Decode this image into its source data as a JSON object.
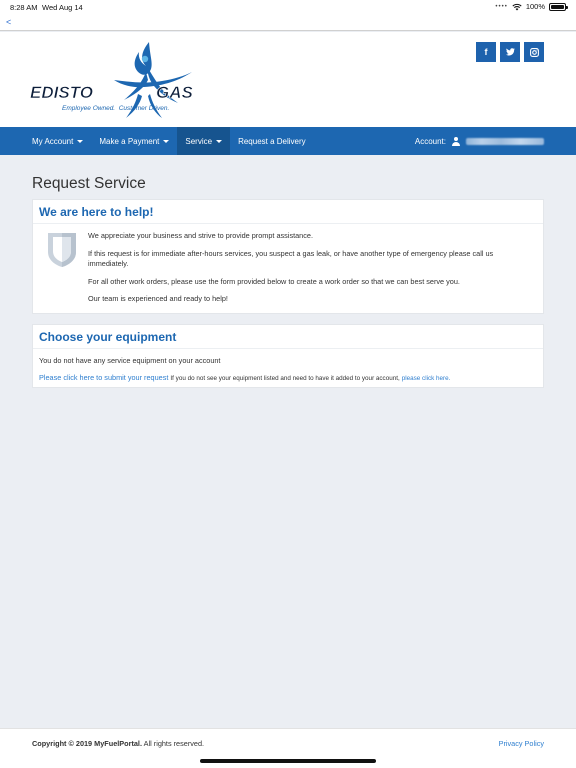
{
  "status_bar": {
    "time": "8:28 AM",
    "date": "Wed Aug 14",
    "battery": "100%",
    "wifi_icon": "wifi-icon",
    "battery_level": 1.0
  },
  "back_label": "<",
  "brand": {
    "logo_text_left": "EDISTO",
    "logo_text_right": "GAS",
    "tagline": "Employee Owned.  Customer Driven.",
    "color": "#1d67b1"
  },
  "social": [
    {
      "icon": "facebook-icon",
      "glyph": "f"
    },
    {
      "icon": "twitter-icon",
      "glyph": "t"
    },
    {
      "icon": "instagram-icon",
      "glyph": "◘"
    }
  ],
  "nav": {
    "items": [
      {
        "label": "My Account",
        "dropdown": true
      },
      {
        "label": "Make a Payment",
        "dropdown": true
      },
      {
        "label": "Service",
        "dropdown": true,
        "active": true
      },
      {
        "label": "Request a Delivery",
        "dropdown": false
      }
    ],
    "account_label": "Account:"
  },
  "page": {
    "title": "Request Service"
  },
  "help_card": {
    "title": "We are here to help!",
    "paragraphs": [
      "We appreciate your business and strive to provide prompt assistance.",
      "If this request is for immediate after-hours services, you suspect a gas leak, or have another type of emergency please call us immediately.",
      "For all other work orders, please use the form provided below to create a work order so that we can best serve you.",
      "Our team is experienced and ready to help!"
    ]
  },
  "equipment_card": {
    "title": "Choose your equipment",
    "empty_message": "You do not have any service equipment on your account",
    "submit_link": "Please click here to submit your request",
    "note": "If you do not see your equipment listed and need to have it added to your account,",
    "note_link": "please click here."
  },
  "footer": {
    "copyright_bold": "Copyright © 2019 MyFuelPortal.",
    "copyright_rest": "All rights reserved.",
    "privacy": "Privacy Policy"
  }
}
